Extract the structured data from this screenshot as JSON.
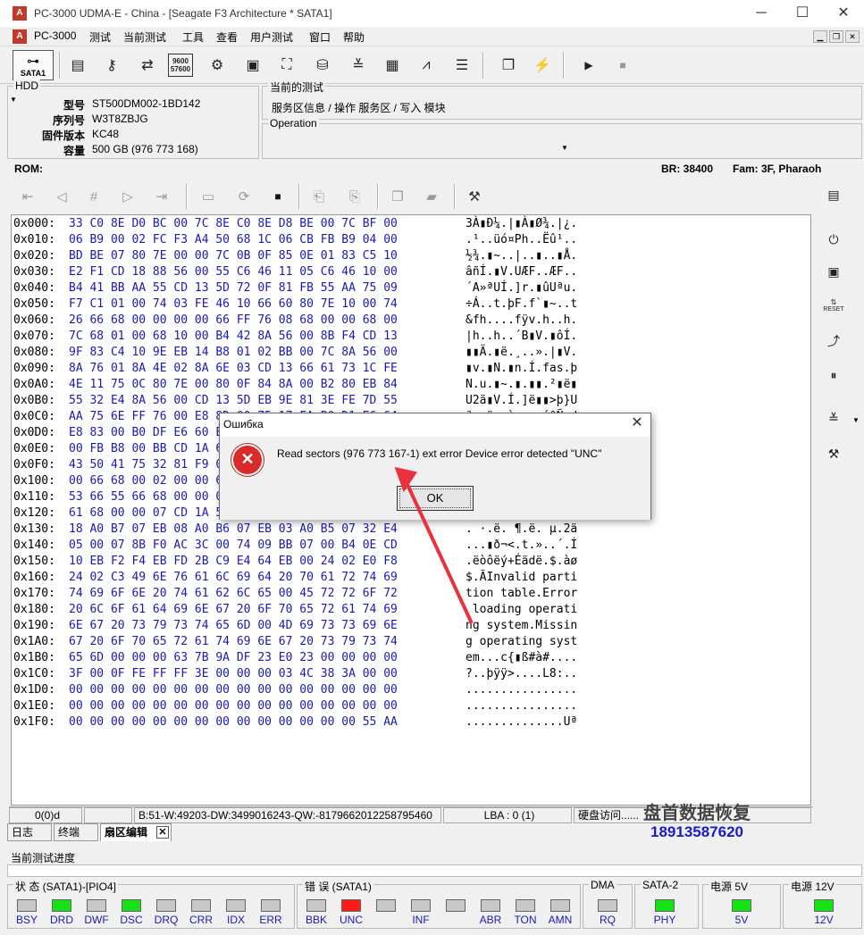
{
  "window": {
    "title": "PC-3000 UDMA-E - China - [Seagate F3 Architecture * SATA1]",
    "icon": "pc3000-app-icon",
    "minimize": "─",
    "maximize": "☐",
    "close": "✕"
  },
  "menu": [
    "PC-3000",
    "测试",
    "当前测试",
    "工具",
    "查看",
    "用户测试",
    "窗口",
    "帮助"
  ],
  "toolbar": {
    "sata_label": "SATA1",
    "speed_top": "9600",
    "speed_bottom": "57600"
  },
  "hdd": {
    "caption": "HDD",
    "rows": [
      {
        "label": "型号",
        "value": "ST500DM002-1BD142"
      },
      {
        "label": "序列号",
        "value": "W3T8ZBJG"
      },
      {
        "label": "固件版本",
        "value": "KC48"
      },
      {
        "label": "容量",
        "value": "500 GB (976 773 168)"
      }
    ]
  },
  "current_test": {
    "caption": "当前的测试",
    "value": "服务区信息 / 操作 服务区 / 写入 模块"
  },
  "operation": {
    "caption": "Operation"
  },
  "rom_bar": {
    "rom": "ROM:",
    "br": "BR: 38400",
    "fam": "Fam: 3F, Pharaoh"
  },
  "hex": [
    {
      "off": "0x000:",
      "bytes": "33 C0 8E D0 BC 00 7C 8E C0 8E D8 BE 00 7C BF 00",
      "ascii": "3À▮Ð¼.|▮À▮Ø¾.|¿."
    },
    {
      "off": "0x010:",
      "bytes": "06 B9 00 02 FC F3 A4 50 68 1C 06 CB FB B9 04 00",
      "ascii": ".¹..üó¤Ph..Ëû¹.."
    },
    {
      "off": "0x020:",
      "bytes": "BD BE 07 80 7E 00 00 7C 0B 0F 85 0E 01 83 C5 10",
      "ascii": "½¾.▮~..|..▮..▮Å."
    },
    {
      "off": "0x030:",
      "bytes": "E2 F1 CD 18 88 56 00 55 C6 46 11 05 C6 46 10 00",
      "ascii": "âñÍ.▮V.UÆF..ÆF.."
    },
    {
      "off": "0x040:",
      "bytes": "B4 41 BB AA 55 CD 13 5D 72 0F 81 FB 55 AA 75 09",
      "ascii": "´A»ªUÍ.]r.▮ûUªu."
    },
    {
      "off": "0x050:",
      "bytes": "F7 C1 01 00 74 03 FE 46 10 66 60 80 7E 10 00 74",
      "ascii": "÷Á..t.þF.f`▮~..t"
    },
    {
      "off": "0x060:",
      "bytes": "26 66 68 00 00 00 00 66 FF 76 08 68 00 00 68 00",
      "ascii": "&fh....fÿv.h..h."
    },
    {
      "off": "0x070:",
      "bytes": "7C 68 01 00 68 10 00 B4 42 8A 56 00 8B F4 CD 13",
      "ascii": "|h..h..´B▮V.▮ôÍ."
    },
    {
      "off": "0x080:",
      "bytes": "9F 83 C4 10 9E EB 14 B8 01 02 BB 00 7C 8A 56 00",
      "ascii": "▮▮Ä.▮ë.¸..».|▮V."
    },
    {
      "off": "0x090:",
      "bytes": "8A 76 01 8A 4E 02 8A 6E 03 CD 13 66 61 73 1C FE",
      "ascii": "▮v.▮N.▮n.Í.fas.þ"
    },
    {
      "off": "0x0A0:",
      "bytes": "4E 11 75 0C 80 7E 00 80 0F 84 8A 00 B2 80 EB 84",
      "ascii": "N.u.▮~.▮.▮▮.²▮ë▮"
    },
    {
      "off": "0x0B0:",
      "bytes": "55 32 E4 8A 56 00 CD 13 5D EB 9E 81 3E FE 7D 55",
      "ascii": "U2ä▮V.Í.]ë▮▮>þ}U"
    },
    {
      "off": "0x0C0:",
      "bytes": "AA 75 6E FF 76 00 E8 8D 00 75 17 FA B0 D1 E6 64",
      "ascii": "ªunÿv.è▮.u.ú°Ñæd"
    },
    {
      "off": "0x0D0:",
      "bytes": "E8 83 00 B0 DF E6 60 E8 7C 00 B0 FF E6 64 E8 75",
      "ascii": "è▮.°ßæ`è|.°ÿædèu"
    },
    {
      "off": "0x0E0:",
      "bytes": "00 FB B8 00 BB CD 1A 66 23 C0 75 3B 66 81 FB 54",
      "ascii": ".û¸.»Í.f#Àu;f▮ûT"
    },
    {
      "off": "0x0F0:",
      "bytes": "43 50 41 75 32 81 F9 02 01 72 2C 66 68 07 BB 00",
      "ascii": "CPAu2▮ù..r,fh.»."
    },
    {
      "off": "0x100:",
      "bytes": "00 66 68 00 02 00 00 66 68 08 00 00 00 66 53 66",
      "ascii": ".fh....fh....fSf"
    },
    {
      "off": "0x110:",
      "bytes": "53 66 55 66 68 00 00 00 00 66 68 00 7C 00 00 66",
      "ascii": "SfUfh....fh.|..f"
    },
    {
      "off": "0x120:",
      "bytes": "61 68 00 00 07 CD 1A 5A 32 F6 EA 00 7C 00 00 CD",
      "ascii": "ah...Í.Z2öê.|..Í"
    },
    {
      "off": "0x130:",
      "bytes": "18 A0 B7 07 EB 08 A0 B6 07 EB 03 A0 B5 07 32 E4",
      "ascii": ". ·.ë. ¶.ë. µ.2ä"
    },
    {
      "off": "0x140:",
      "bytes": "05 00 07 8B F0 AC 3C 00 74 09 BB 07 00 B4 0E CD",
      "ascii": "...▮ð¬<.t.»..´.Í"
    },
    {
      "off": "0x150:",
      "bytes": "10 EB F2 F4 EB FD 2B C9 E4 64 EB 00 24 02 E0 F8",
      "ascii": ".ëòôëý+Éädë.$.àø"
    },
    {
      "off": "0x160:",
      "bytes": "24 02 C3 49 6E 76 61 6C 69 64 20 70 61 72 74 69",
      "ascii": "$.ÃInvalid parti"
    },
    {
      "off": "0x170:",
      "bytes": "74 69 6F 6E 20 74 61 62 6C 65 00 45 72 72 6F 72",
      "ascii": "tion table.Error"
    },
    {
      "off": "0x180:",
      "bytes": "20 6C 6F 61 64 69 6E 67 20 6F 70 65 72 61 74 69",
      "ascii": " loading operati"
    },
    {
      "off": "0x190:",
      "bytes": "6E 67 20 73 79 73 74 65 6D 00 4D 69 73 73 69 6E",
      "ascii": "ng system.Missin"
    },
    {
      "off": "0x1A0:",
      "bytes": "67 20 6F 70 65 72 61 74 69 6E 67 20 73 79 73 74",
      "ascii": "g operating syst"
    },
    {
      "off": "0x1B0:",
      "bytes": "65 6D 00 00 00 63 7B 9A DF 23 E0 23 00 00 00 00",
      "ascii": "em...c{▮ß#à#...."
    },
    {
      "off": "0x1C0:",
      "bytes": "3F 00 0F FE FF FF 3E 00 00 00 03 4C 38 3A 00 00",
      "ascii": "?..þÿÿ>....L8:.."
    },
    {
      "off": "0x1D0:",
      "bytes": "00 00 00 00 00 00 00 00 00 00 00 00 00 00 00 00",
      "ascii": "................"
    },
    {
      "off": "0x1E0:",
      "bytes": "00 00 00 00 00 00 00 00 00 00 00 00 00 00 00 00",
      "ascii": "................"
    },
    {
      "off": "0x1F0:",
      "bytes": "00 00 00 00 00 00 00 00 00 00 00 00 00 00 55 AA",
      "ascii": "..............Uª"
    }
  ],
  "statusline": {
    "pos": "0(0)d",
    "values": "B:51-W:49203-DW:3499016243-QW:-8179662012258795460",
    "lba": "LBA : 0 (1)",
    "disk": "硬盘访问......"
  },
  "tabs": [
    "日志",
    "终端",
    "扇区编辑"
  ],
  "tab_close": "✕",
  "progress": {
    "label": "当前测试进度",
    "value": 0
  },
  "status_group": {
    "title": "状 态 (SATA1)-[PIO4]",
    "leds": [
      {
        "label": "BSY",
        "state": "off"
      },
      {
        "label": "DRD",
        "state": "green"
      },
      {
        "label": "DWF",
        "state": "off"
      },
      {
        "label": "DSC",
        "state": "green"
      },
      {
        "label": "DRQ",
        "state": "off"
      },
      {
        "label": "CRR",
        "state": "off"
      },
      {
        "label": "IDX",
        "state": "off"
      },
      {
        "label": "ERR",
        "state": "off"
      }
    ]
  },
  "error_group": {
    "title": "错 误 (SATA1)",
    "leds": [
      {
        "label": "BBK",
        "state": "off"
      },
      {
        "label": "UNC",
        "state": "red"
      },
      {
        "label": "",
        "state": "off"
      },
      {
        "label": "INF",
        "state": "off"
      },
      {
        "label": "",
        "state": "off"
      },
      {
        "label": "ABR",
        "state": "off"
      },
      {
        "label": "TON",
        "state": "off"
      },
      {
        "label": "AMN",
        "state": "off"
      }
    ]
  },
  "dma_group": {
    "title": "DMA",
    "label": "RQ",
    "state": "off"
  },
  "sata2_group": {
    "title": "SATA-2",
    "label": "PHY",
    "state": "green"
  },
  "p5_group": {
    "title": "电源 5V",
    "label": "5V",
    "state": "green"
  },
  "p12_group": {
    "title": "电源 12V",
    "label": "12V",
    "state": "green"
  },
  "dialog": {
    "title": "Ошибка",
    "message": "Read sectors (976 773 167-1) ext error Device error detected \"UNC\"",
    "ok": "OK",
    "close": "✕",
    "icon_glyph": "✕"
  },
  "watermark": {
    "name": "盘首数据恢复",
    "phone": "18913587620"
  },
  "colors": {
    "led_green": "#16e016",
    "led_red": "#ff1a1a",
    "hex_bytes": "#1a1ab0",
    "arrow": "#e8323c"
  }
}
